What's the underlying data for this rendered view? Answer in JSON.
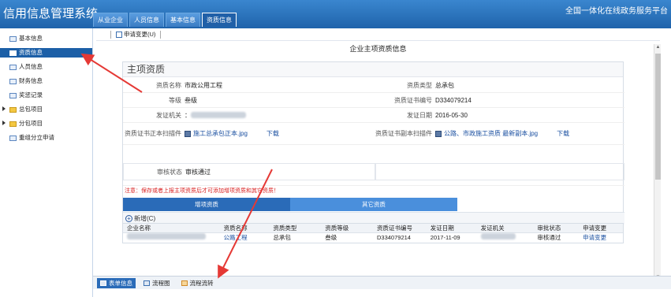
{
  "header": {
    "app_title": "信用信息管理系统",
    "gov_title": "全国一体化在线政务服务平台",
    "tabs": [
      "从业企业",
      "人员信息",
      "基本信息",
      "资质信息"
    ]
  },
  "sidebar": {
    "items": [
      {
        "label": "基本信息",
        "icon": "form-icon"
      },
      {
        "label": "资质信息",
        "icon": "form-icon"
      },
      {
        "label": "人员信息",
        "icon": "form-icon"
      },
      {
        "label": "财务信息",
        "icon": "form-icon"
      },
      {
        "label": "奖惩记录",
        "icon": "form-icon"
      },
      {
        "label": "总包项目",
        "icon": "folder-icon"
      },
      {
        "label": "分包项目",
        "icon": "folder-icon"
      },
      {
        "label": "重组分立申请",
        "icon": "form-icon"
      }
    ]
  },
  "toolbar": {
    "apply_change": "申请变更(U)"
  },
  "page_title": "企业主项资质信息",
  "section": {
    "title": "主项资质",
    "fields": {
      "qual_name_label": "资质名称",
      "qual_name": "市政公用工程",
      "qual_type_label": "资质类型",
      "qual_type": "总承包",
      "level_label": "等级",
      "level": "叁级",
      "cert_no_label": "资质证书编号",
      "cert_no": "D334079214",
      "issuer_label": "发证机关",
      "issuer_prefix": "：",
      "issue_date_label": "发证日期",
      "issue_date": "2016-05-30",
      "scan_front_label": "资质证书正本扫描件",
      "scan_front_file": "施工总承包正本.jpg",
      "scan_back_label": "资质证书副本扫描件",
      "scan_back_file": "公路、市政施工资质 最新副本.jpg",
      "download": "下载",
      "audit_label": "审核状态",
      "audit_value": "审核通过"
    },
    "notice": "注意：保存或者上报主项资质后才可添加增项资质和其它资质！",
    "subtabs": [
      "增项资质",
      "其它资质"
    ],
    "add_label": "新增(C)"
  },
  "table": {
    "headers": [
      "企业名称",
      "资质名称",
      "资质类型",
      "资质等级",
      "资质证书编号",
      "发证日期",
      "发证机关",
      "审批状态",
      "申请变更"
    ],
    "rows": [
      [
        "",
        "公路工程",
        "总承包",
        "叁级",
        "D334079214",
        "2017-11-09",
        "",
        "审核通过",
        "申请变更"
      ]
    ]
  },
  "bottom_tabs": [
    "表单信息",
    "流程图",
    "流程流转"
  ],
  "colors": {
    "accent": "#1c5fa7",
    "notice": "#d92020",
    "annotation_arrow": "#e53935"
  }
}
